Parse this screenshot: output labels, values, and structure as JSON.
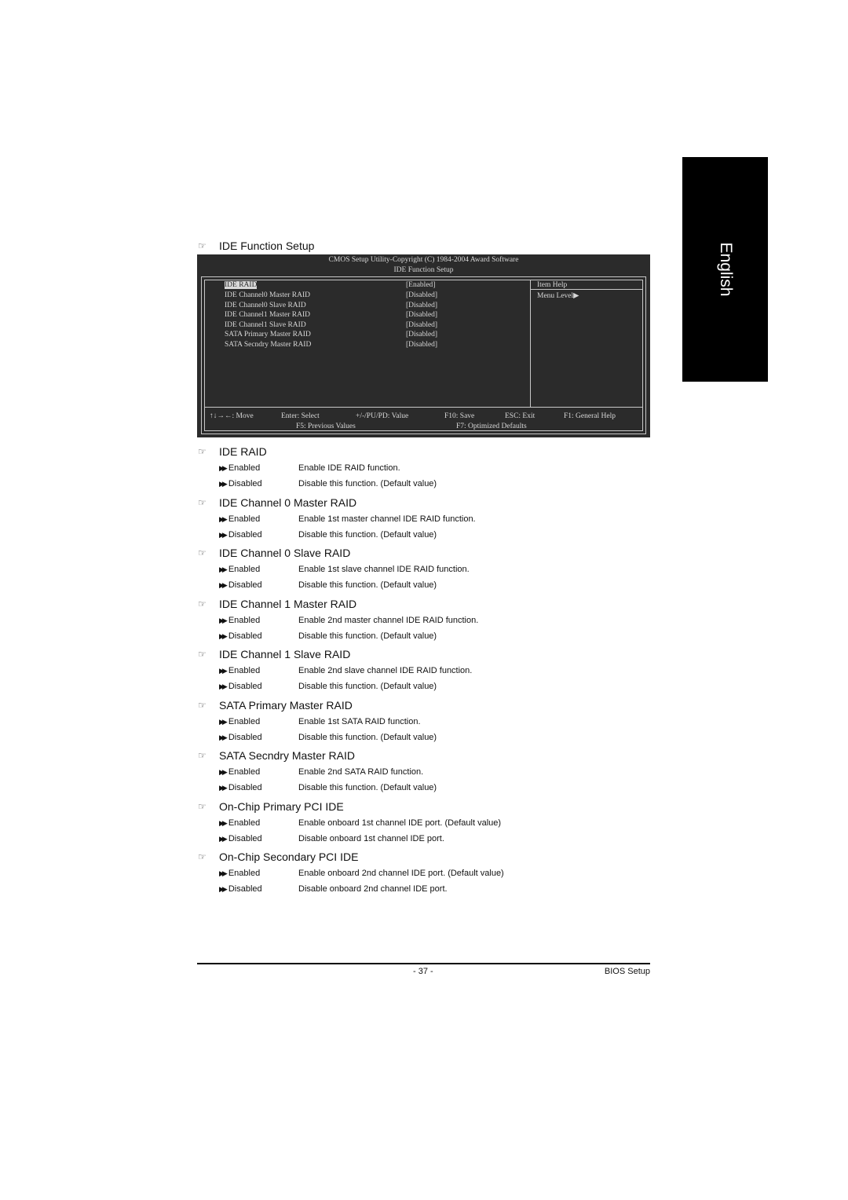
{
  "language_tab": "English",
  "page_heading": "IDE Function Setup",
  "bios": {
    "header_line1": "CMOS Setup Utility-Copyright (C) 1984-2004 Award Software",
    "header_line2": "IDE Function Setup",
    "items": [
      {
        "label": "IDE RAID",
        "value": "[Enabled]",
        "selected": true
      },
      {
        "label": "IDE Channel0 Master RAID",
        "value": "[Disabled]"
      },
      {
        "label": "IDE Channel0 Slave RAID",
        "value": "[Disabled]"
      },
      {
        "label": "IDE Channel1 Master RAID",
        "value": "[Disabled]"
      },
      {
        "label": "IDE Channel1 Slave RAID",
        "value": "[Disabled]"
      },
      {
        "label": "SATA Primary Master RAID",
        "value": "[Disabled]"
      },
      {
        "label": "SATA Secndry Master RAID",
        "value": "[Disabled]"
      }
    ],
    "help_title": "Item Help",
    "menu_level": "Menu Level▶",
    "footer": {
      "move": "↑↓→←: Move",
      "enter": "Enter: Select",
      "value": "+/-/PU/PD: Value",
      "save": "F10: Save",
      "exit": "ESC: Exit",
      "help": "F1: General Help",
      "previous": "F5: Previous Values",
      "defaults": "F7: Optimized Defaults"
    }
  },
  "sections": [
    {
      "title": "IDE RAID",
      "options": [
        {
          "name": "Enabled",
          "desc": "Enable IDE RAID function."
        },
        {
          "name": "Disabled",
          "desc": "Disable this function. (Default value)"
        }
      ]
    },
    {
      "title": "IDE Channel 0 Master RAID",
      "options": [
        {
          "name": "Enabled",
          "desc": "Enable 1st master channel IDE RAID function."
        },
        {
          "name": "Disabled",
          "desc": "Disable this function. (Default value)"
        }
      ]
    },
    {
      "title": "IDE Channel 0 Slave RAID",
      "options": [
        {
          "name": "Enabled",
          "desc": "Enable 1st slave channel IDE RAID function."
        },
        {
          "name": "Disabled",
          "desc": "Disable this function. (Default value)"
        }
      ]
    },
    {
      "title": "IDE Channel 1 Master RAID",
      "options": [
        {
          "name": "Enabled",
          "desc": "Enable 2nd master channel IDE RAID function."
        },
        {
          "name": "Disabled",
          "desc": "Disable this function. (Default value)"
        }
      ]
    },
    {
      "title": "IDE Channel 1 Slave RAID",
      "options": [
        {
          "name": "Enabled",
          "desc": "Enable 2nd slave channel IDE RAID function."
        },
        {
          "name": "Disabled",
          "desc": "Disable this function. (Default value)"
        }
      ]
    },
    {
      "title": "SATA Primary Master RAID",
      "options": [
        {
          "name": "Enabled",
          "desc": "Enable 1st SATA RAID function."
        },
        {
          "name": "Disabled",
          "desc": "Disable this function. (Default value)"
        }
      ]
    },
    {
      "title": "SATA Secndry Master RAID",
      "options": [
        {
          "name": "Enabled",
          "desc": "Enable 2nd SATA RAID function."
        },
        {
          "name": "Disabled",
          "desc": "Disable this function. (Default value)"
        }
      ]
    },
    {
      "title": "On-Chip Primary PCI IDE",
      "options": [
        {
          "name": "Enabled",
          "desc": "Enable onboard 1st channel IDE port. (Default value)"
        },
        {
          "name": "Disabled",
          "desc": "Disable onboard 1st channel IDE port."
        }
      ]
    },
    {
      "title": "On-Chip Secondary PCI IDE",
      "options": [
        {
          "name": "Enabled",
          "desc": "Enable onboard 2nd channel IDE port. (Default value)"
        },
        {
          "name": "Disabled",
          "desc": "Disable onboard 2nd channel IDE port."
        }
      ]
    }
  ],
  "icons": {
    "section": "pointing-hand-icon",
    "option": "double-arrow-icon"
  },
  "footer": {
    "page_number": "- 37 -",
    "section_name": "BIOS Setup"
  }
}
